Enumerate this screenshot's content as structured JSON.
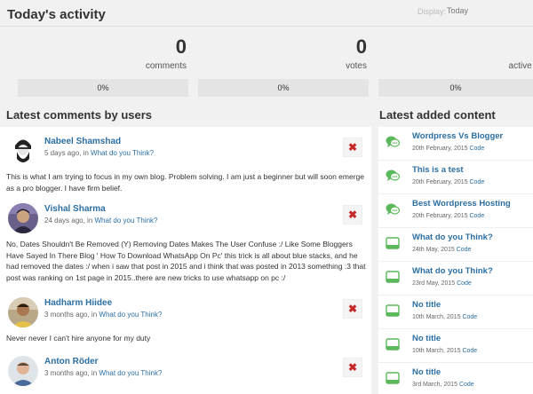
{
  "header": {
    "title": "Today's activity",
    "display_label": "Display:",
    "display_value": "Today"
  },
  "stats": [
    {
      "value": "0",
      "label": "comments",
      "percent": "0%"
    },
    {
      "value": "0",
      "label": "votes",
      "percent": "0%"
    },
    {
      "value": "",
      "label": "active us",
      "percent": "0%"
    }
  ],
  "comments_section": {
    "title": "Latest comments by users",
    "items": [
      {
        "author": "Nabeel Shamshad",
        "time": "5 days ago",
        "separator": ", in",
        "target": "What do you Think?",
        "text": "This is what I am trying to focus in my own blog. Problem solving. I am just a beginner but will soon emerge as a pro blogger. I have firm belief."
      },
      {
        "author": "Vishal Sharma",
        "time": "24 days ago",
        "separator": ", in",
        "target": "What do you Think?",
        "text": "No, Dates Shouldn't Be Removed (Y) Removing Dates Makes The User Confuse :/ Like Some Bloggers Have Sayed In There Blog ' How To Download WhatsApp On Pc' this trick is all about blue stacks, and he had removed the dates :/ when i saw that post in 2015 and i think that was posted in 2013 something :3 that post was ranking on 1st page in 2015..there are new tricks to use whatsapp on pc :/"
      },
      {
        "author": "Hadharm Hiidee",
        "time": "3 months ago",
        "separator": ", in",
        "target": "What do you Think?",
        "text": "Never never I can't hire anyone for my duty"
      },
      {
        "author": "Anton Röder",
        "time": "3 months ago",
        "separator": ", in",
        "target": "What do you Think?",
        "text": ""
      }
    ],
    "delete_glyph": "✖"
  },
  "content_section": {
    "title": "Latest added content",
    "items": [
      {
        "title": "Wordpress Vs Blogger",
        "date": "20th February, 2015",
        "type": "Code",
        "icon": "discussion-icon"
      },
      {
        "title": "This is a test",
        "date": "20th February, 2015",
        "type": "Code",
        "icon": "discussion-icon"
      },
      {
        "title": "Best Wordpress Hosting",
        "date": "20th February, 2015",
        "type": "Code",
        "icon": "discussion-icon"
      },
      {
        "title": "What do you Think?",
        "date": "24th May, 2015",
        "type": "Code",
        "icon": "page-icon"
      },
      {
        "title": "What do you Think?",
        "date": "23rd May, 2015",
        "type": "Code",
        "icon": "page-icon"
      },
      {
        "title": "No title",
        "date": "10th March, 2015",
        "type": "Code",
        "icon": "page-icon"
      },
      {
        "title": "No title",
        "date": "10th March, 2015",
        "type": "Code",
        "icon": "page-icon"
      },
      {
        "title": "No title",
        "date": "3rd March, 2015",
        "type": "Code",
        "icon": "page-icon"
      }
    ]
  },
  "colors": {
    "link": "#2b6fa5",
    "icon_green": "#5cb85c",
    "delete_red": "#c62828",
    "bar_bg": "#e4e4e4"
  }
}
